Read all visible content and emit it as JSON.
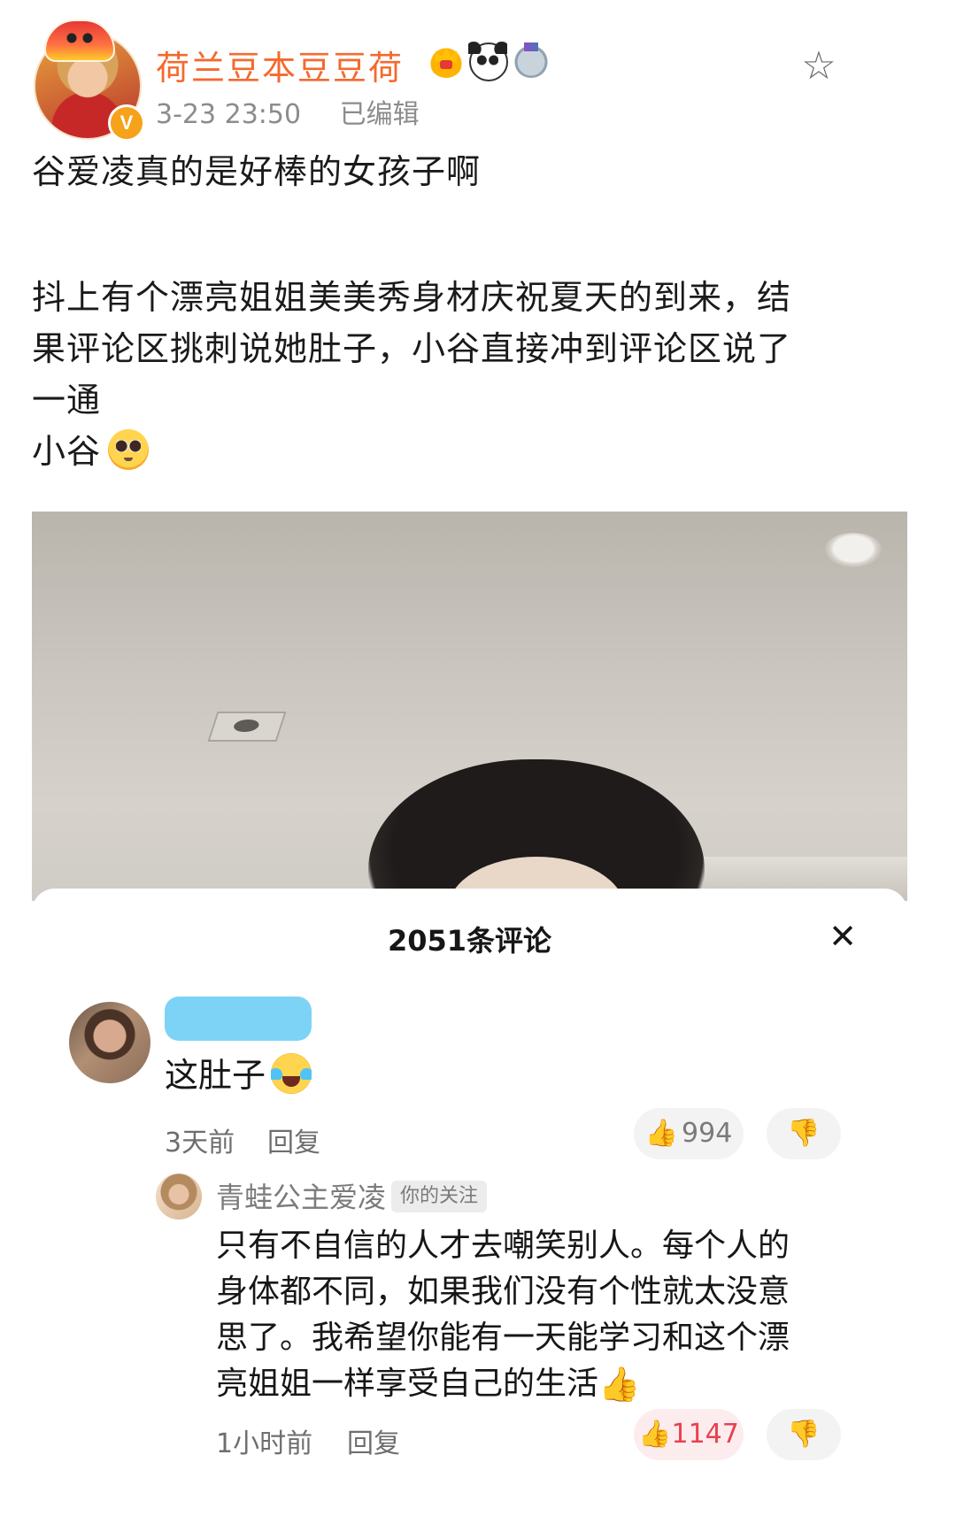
{
  "post": {
    "username": "荷兰豆本豆豆荷",
    "timestamp": "3-23 23:50",
    "edited_label": "已编辑",
    "text_lines": {
      "line1": "谷爱凌真的是好棒的女孩子啊",
      "line2": "抖上有个漂亮姐姐美美秀身材庆祝夏天的到来，结",
      "line3": "果评论区挑刺说她肚子，小谷直接冲到评论区说了",
      "line4": "一通",
      "line5": "小谷"
    },
    "icons": {
      "badges": [
        "crown-icon",
        "panda-icon",
        "medal-icon"
      ],
      "favorite": "star-outline-icon",
      "verified": "verified-v-icon"
    }
  },
  "comments_panel": {
    "title": "2051条评论",
    "close_glyph": "✕",
    "comment": {
      "text": "这肚子",
      "time": "3天前",
      "reply_label": "回复",
      "likes": "994",
      "like_icon": "👍",
      "dislike_icon": "👎"
    },
    "reply": {
      "author": "青蛙公主爱凌",
      "follow_badge": "你的关注",
      "text_lines": {
        "l1": "只有不自信的人才去嘲笑别人。每个人的",
        "l2": "身体都不同，如果我们没有个性就太没意",
        "l3": "思了。我希望你能有一天能学习和这个漂",
        "l4": "亮姐姐一样享受自己的生活"
      },
      "emoji": "👍",
      "time": "1小时前",
      "reply_label": "回复",
      "likes": "1147",
      "like_icon": "👍",
      "dislike_icon": "👎"
    }
  },
  "colors": {
    "username": "#f36a2e",
    "meta": "#8c8c8c",
    "redaction": "#7dd3f5",
    "liked": "#e8414f",
    "verified": "#f6a21a"
  }
}
